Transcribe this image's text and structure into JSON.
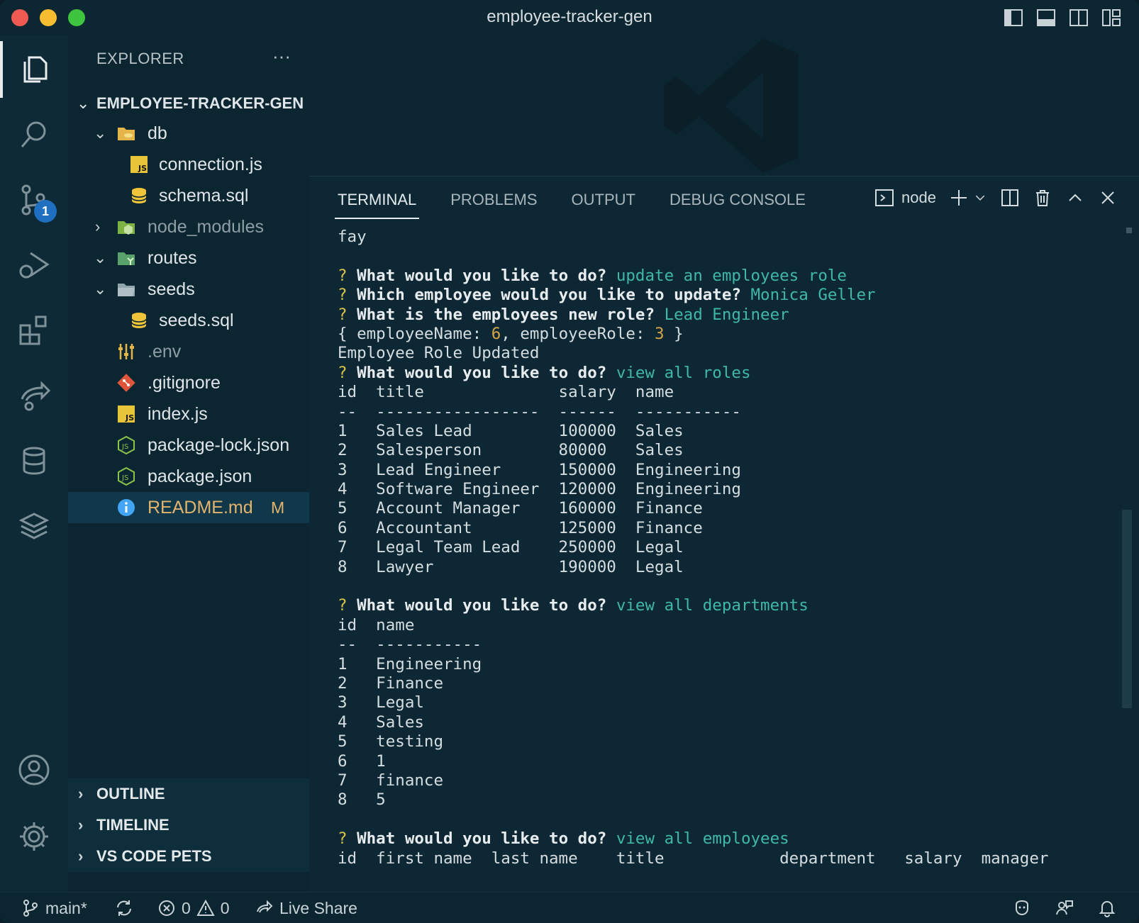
{
  "window": {
    "title": "employee-tracker-gen"
  },
  "activity": {
    "scm_badge": "1"
  },
  "explorer": {
    "header": "EXPLORER",
    "more": "···",
    "project": "EMPLOYEE-TRACKER-GEN",
    "items": [
      {
        "name": "db"
      },
      {
        "name": "connection.js"
      },
      {
        "name": "schema.sql"
      },
      {
        "name": "node_modules"
      },
      {
        "name": "routes"
      },
      {
        "name": "seeds"
      },
      {
        "name": "seeds.sql"
      },
      {
        "name": ".env"
      },
      {
        "name": ".gitignore"
      },
      {
        "name": "index.js"
      },
      {
        "name": "package-lock.json"
      },
      {
        "name": "package.json"
      },
      {
        "name": "README.md",
        "badge": "M"
      }
    ],
    "sections": [
      "OUTLINE",
      "TIMELINE",
      "VS CODE PETS"
    ]
  },
  "panel": {
    "tabs": [
      "TERMINAL",
      "PROBLEMS",
      "OUTPUT",
      "DEBUG CONSOLE"
    ],
    "terminal_name": "node"
  },
  "terminal": {
    "l0": "fay",
    "q1": "What would you like to do?",
    "a1": "update an employees role",
    "q2": "Which employee would you like to update?",
    "a2": "Monica Geller",
    "q3": "What is the employees new role?",
    "a3": "Lead Engineer",
    "obj_a": "{ employeeName: ",
    "obj_n1": "6",
    "obj_b": ", employeeRole: ",
    "obj_n2": "3",
    "obj_c": " }",
    "updated": "Employee Role Updated",
    "q4": "What would you like to do?",
    "a4": "view all roles",
    "roles_header": "id  title              salary  name",
    "roles_sep": "--  -----------------  ------  -----------",
    "roles": [
      "1   Sales Lead         100000  Sales",
      "2   Salesperson        80000   Sales",
      "3   Lead Engineer      150000  Engineering",
      "4   Software Engineer  120000  Engineering",
      "5   Account Manager    160000  Finance",
      "6   Accountant         125000  Finance",
      "7   Legal Team Lead    250000  Legal",
      "8   Lawyer             190000  Legal"
    ],
    "q5": "What would you like to do?",
    "a5": "view all departments",
    "dept_header": "id  name",
    "dept_sep": "--  -----------",
    "depts": [
      "1   Engineering",
      "2   Finance",
      "3   Legal",
      "4   Sales",
      "5   testing",
      "6   1",
      "7   finance",
      "8   5"
    ],
    "q6": "What would you like to do?",
    "a6": "view all employees",
    "emp_header": "id  first name  last name    title            department   salary  manager"
  },
  "status": {
    "branch": "main*",
    "errors": "0",
    "warnings": "0",
    "live_share": "Live Share"
  },
  "colors": {
    "accent_answer": "#3fb8a8",
    "question_mark": "#d8c24a",
    "modified": "#e2b36c",
    "badge": "#1f70c1"
  }
}
